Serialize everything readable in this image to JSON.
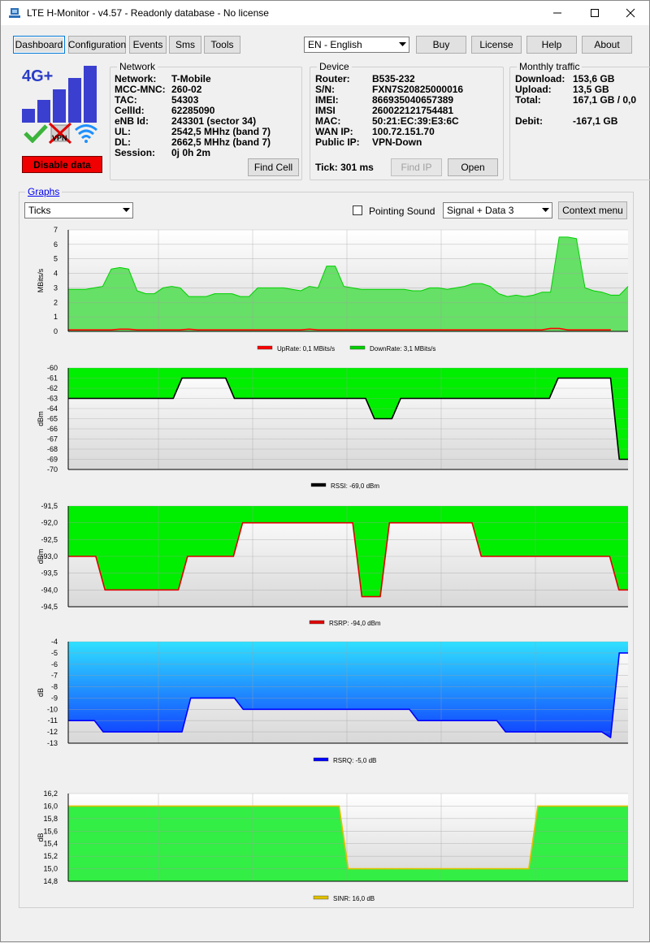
{
  "app": {
    "title": "LTE H-Monitor - v4.57 - Readonly database - No license",
    "tabs": [
      "Dashboard",
      "Configuration",
      "Events",
      "Sms",
      "Tools"
    ],
    "language": "EN - English",
    "buttons": {
      "buy": "Buy",
      "license": "License",
      "help": "Help",
      "about": "About"
    }
  },
  "status": {
    "network_badge": "4G+",
    "vpn_label": "VPN",
    "disable_data": "Disable data",
    "signal_bars": 5
  },
  "network": {
    "legend": "Network",
    "rows": [
      {
        "k": "Network:",
        "v": "T-Mobile"
      },
      {
        "k": "MCC-MNC:",
        "v": "260-02"
      },
      {
        "k": "TAC:",
        "v": "54303"
      },
      {
        "k": "CellId:",
        "v": "62285090"
      },
      {
        "k": "eNB Id:",
        "v": "243301 (sector 34)"
      },
      {
        "k": "UL:",
        "v": "2542,5 MHhz (band 7)"
      },
      {
        "k": "DL:",
        "v": "2662,5 MHhz (band 7)"
      },
      {
        "k": "Session:",
        "v": "0j 0h 2m"
      }
    ],
    "find_cell": "Find Cell"
  },
  "device": {
    "legend": "Device",
    "rows": [
      {
        "k": "Router:",
        "v": "B535-232"
      },
      {
        "k": "S/N:",
        "v": "FXN7S20825000016"
      },
      {
        "k": "IMEI:",
        "v": "866935040657389"
      },
      {
        "k": "IMSI",
        "v": "260022121754481"
      },
      {
        "k": "MAC:",
        "v": "50:21:EC:39:E3:6C"
      },
      {
        "k": "WAN IP:",
        "v": "100.72.151.70"
      },
      {
        "k": "Public IP:",
        "v": " VPN-Down"
      }
    ],
    "tick": "Tick: 301 ms",
    "find_ip": "Find IP",
    "open": "Open"
  },
  "traffic": {
    "legend": "Monthly traffic",
    "rows": [
      {
        "k": "Download:",
        "v": "153,6 GB"
      },
      {
        "k": "Upload:",
        "v": "13,5 GB"
      },
      {
        "k": "Total:",
        "v": "167,1 GB / 0,0"
      },
      {
        "k": "Debit:",
        "v": "-167,1 GB"
      }
    ]
  },
  "graphs": {
    "link": "Graphs",
    "mode": "Ticks",
    "pointing_sound": "Pointing Sound",
    "pointing_sound_checked": false,
    "view": "Signal + Data 3",
    "context_menu": "Context menu"
  },
  "chart_data": [
    {
      "type": "area",
      "ylabel": "MBits/s",
      "ylim": [
        0,
        7
      ],
      "yticks": [
        "7",
        "6",
        "5",
        "4",
        "3",
        "2",
        "1",
        "0"
      ],
      "series": [
        {
          "name": "UpRate: 0,1 MBits/s",
          "color": "#ff0000",
          "values": [
            0.1,
            0.1,
            0.1,
            0.1,
            0.1,
            0.1,
            0.15,
            0.15,
            0.1,
            0.1,
            0.1,
            0.1,
            0.1,
            0.1,
            0.15,
            0.1,
            0.1,
            0.1,
            0.1,
            0.1,
            0.1,
            0.1,
            0.1,
            0.1,
            0.1,
            0.1,
            0.1,
            0.1,
            0.15,
            0.1,
            0.1,
            0.1,
            0.1,
            0.1,
            0.1,
            0.1,
            0.1,
            0.1,
            0.1,
            0.1,
            0.1,
            0.1,
            0.1,
            0.1,
            0.1,
            0.1,
            0.1,
            0.1,
            0.1,
            0.1,
            0.1,
            0.1,
            0.1,
            0.1,
            0.1,
            0.1,
            0.2,
            0.2,
            0.1,
            0.1,
            0.1,
            0.1,
            0.1,
            0.1
          ]
        },
        {
          "name": "DownRate: 3,1 MBits/s",
          "color": "#00d000",
          "values": [
            2.9,
            2.9,
            2.9,
            3.0,
            3.1,
            4.3,
            4.4,
            4.3,
            2.8,
            2.6,
            2.6,
            3.0,
            3.1,
            3.0,
            2.4,
            2.4,
            2.4,
            2.6,
            2.6,
            2.6,
            2.4,
            2.4,
            3.0,
            3.0,
            3.0,
            3.0,
            2.9,
            2.8,
            3.1,
            3.0,
            4.5,
            4.5,
            3.1,
            3.0,
            2.9,
            2.9,
            2.9,
            2.9,
            2.9,
            2.9,
            2.8,
            2.8,
            3.0,
            3.0,
            2.9,
            3.0,
            3.1,
            3.3,
            3.3,
            3.1,
            2.6,
            2.4,
            2.5,
            2.4,
            2.5,
            2.7,
            2.7,
            6.5,
            6.5,
            6.4,
            3.0,
            2.8,
            2.7,
            2.5,
            2.5,
            3.1
          ]
        }
      ]
    },
    {
      "type": "area",
      "ylabel": "dBm",
      "ylim": [
        -70,
        -60
      ],
      "yticks": [
        "-60",
        "-61",
        "-62",
        "-63",
        "-64",
        "-65",
        "-66",
        "-67",
        "-68",
        "-69",
        "-70"
      ],
      "fill_above": "#00ee00",
      "series": [
        {
          "name": "RSSI: -69,0 dBm",
          "color": "#000000",
          "values": [
            -63,
            -63,
            -63,
            -63,
            -63,
            -63,
            -63,
            -63,
            -63,
            -63,
            -63,
            -63,
            -63,
            -61,
            -61,
            -61,
            -61,
            -61,
            -61,
            -63,
            -63,
            -63,
            -63,
            -63,
            -63,
            -63,
            -63,
            -63,
            -63,
            -63,
            -63,
            -63,
            -63,
            -63,
            -63,
            -65,
            -65,
            -65,
            -63,
            -63,
            -63,
            -63,
            -63,
            -63,
            -63,
            -63,
            -63,
            -63,
            -63,
            -63,
            -63,
            -63,
            -63,
            -63,
            -63,
            -63,
            -61,
            -61,
            -61,
            -61,
            -61,
            -61,
            -61,
            -69,
            -69
          ]
        }
      ]
    },
    {
      "type": "area",
      "ylabel": "dBm",
      "ylim": [
        -94.5,
        -91.5
      ],
      "yticks": [
        "-91,5",
        "-92,0",
        "-92,5",
        "-93,0",
        "-93,5",
        "-94,0",
        "-94,5"
      ],
      "fill_above": "#00ee00",
      "series": [
        {
          "name": "RSRP: -94,0 dBm",
          "color": "#e00000",
          "values": [
            -93,
            -93,
            -93,
            -93,
            -94,
            -94,
            -94,
            -94,
            -94,
            -94,
            -94,
            -94,
            -94,
            -93,
            -93,
            -93,
            -93,
            -93,
            -93,
            -92,
            -92,
            -92,
            -92,
            -92,
            -92,
            -92,
            -92,
            -92,
            -92,
            -92,
            -92,
            -92,
            -94.2,
            -94.2,
            -94.2,
            -92,
            -92,
            -92,
            -92,
            -92,
            -92,
            -92,
            -92,
            -92,
            -92,
            -93,
            -93,
            -93,
            -93,
            -93,
            -93,
            -93,
            -93,
            -93,
            -93,
            -93,
            -93,
            -93,
            -93,
            -93,
            -94,
            -94
          ]
        }
      ]
    },
    {
      "type": "area",
      "ylabel": "dB",
      "ylim": [
        -13,
        -4
      ],
      "yticks": [
        "-4",
        "-5",
        "-6",
        "-7",
        "-8",
        "-9",
        "-10",
        "-11",
        "-12",
        "-13"
      ],
      "series": [
        {
          "name": "RSRQ: -5,0 dB",
          "color": "#0000ff",
          "values": [
            -11,
            -11,
            -11,
            -11,
            -12,
            -12,
            -12,
            -12,
            -12,
            -12,
            -12,
            -12,
            -12,
            -12,
            -9,
            -9,
            -9,
            -9,
            -9,
            -9,
            -10,
            -10,
            -10,
            -10,
            -10,
            -10,
            -10,
            -10,
            -10,
            -10,
            -10,
            -10,
            -10,
            -10,
            -10,
            -10,
            -10,
            -10,
            -10,
            -10,
            -11,
            -11,
            -11,
            -11,
            -11,
            -11,
            -11,
            -11,
            -11,
            -11,
            -12,
            -12,
            -12,
            -12,
            -12,
            -12,
            -12,
            -12,
            -12,
            -12,
            -12,
            -12,
            -12.5,
            -5,
            -5
          ]
        }
      ]
    },
    {
      "type": "area",
      "ylabel": "dB",
      "ylim": [
        14.8,
        16.2
      ],
      "yticks": [
        "16,2",
        "16,0",
        "15,8",
        "15,6",
        "15,4",
        "15,2",
        "15,0",
        "14,8"
      ],
      "series": [
        {
          "name": "SINR: 16,0 dB",
          "color": "#e0c000",
          "values": [
            16,
            16,
            16,
            16,
            16,
            16,
            16,
            16,
            16,
            16,
            16,
            16,
            16,
            16,
            16,
            16,
            16,
            16,
            16,
            16,
            16,
            16,
            16,
            16,
            16,
            16,
            16,
            16,
            16,
            16,
            16,
            15,
            15,
            15,
            15,
            15,
            15,
            15,
            15,
            15,
            15,
            15,
            15,
            15,
            15,
            15,
            15,
            15,
            15,
            15,
            15,
            15,
            16,
            16,
            16,
            16,
            16,
            16,
            16,
            16,
            16,
            16,
            16
          ]
        }
      ]
    }
  ]
}
